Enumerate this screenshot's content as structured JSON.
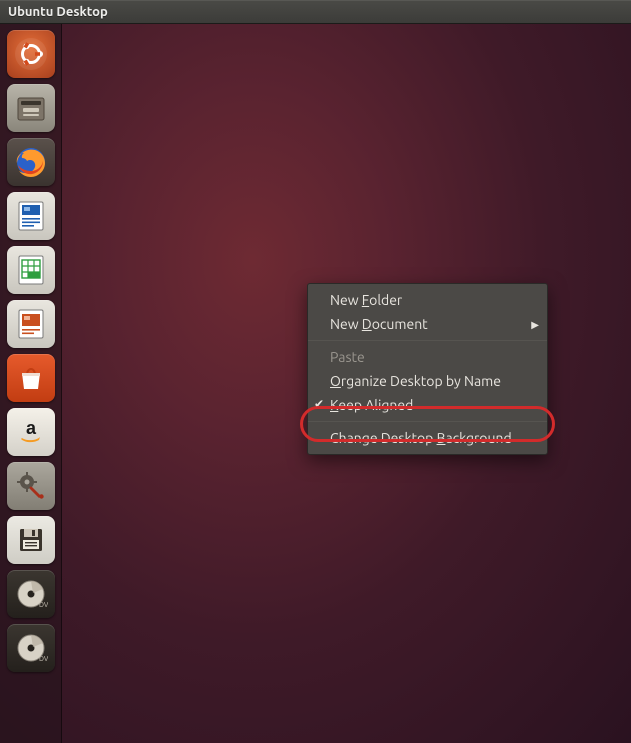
{
  "top_panel": {
    "title": "Ubuntu Desktop"
  },
  "launcher": {
    "items": [
      {
        "name": "dash-home",
        "tooltip": "Dash Home"
      },
      {
        "name": "files",
        "tooltip": "Files"
      },
      {
        "name": "firefox",
        "tooltip": "Firefox Web Browser"
      },
      {
        "name": "libreoffice-writer",
        "tooltip": "LibreOffice Writer"
      },
      {
        "name": "libreoffice-calc",
        "tooltip": "LibreOffice Calc"
      },
      {
        "name": "libreoffice-impress",
        "tooltip": "LibreOffice Impress"
      },
      {
        "name": "ubuntu-software-center",
        "tooltip": "Ubuntu Software Center"
      },
      {
        "name": "amazon",
        "tooltip": "Amazon"
      },
      {
        "name": "system-settings",
        "tooltip": "System Settings"
      },
      {
        "name": "save-device",
        "tooltip": "Floppy Disk"
      },
      {
        "name": "disc-1",
        "tooltip": "Disc"
      },
      {
        "name": "disc-2",
        "tooltip": "Disc"
      }
    ]
  },
  "context_menu": {
    "items": [
      {
        "kind": "item",
        "label": "New Folder",
        "mnemonic_index": 4,
        "enabled": true,
        "submenu": false
      },
      {
        "kind": "item",
        "label": "New Document",
        "mnemonic_index": 4,
        "enabled": true,
        "submenu": true
      },
      {
        "kind": "separator"
      },
      {
        "kind": "item",
        "label": "Paste",
        "mnemonic_index": -1,
        "enabled": false,
        "submenu": false
      },
      {
        "kind": "item",
        "label": "Organize Desktop by Name",
        "mnemonic_index": 0,
        "enabled": true,
        "submenu": false
      },
      {
        "kind": "check",
        "label": "Keep Aligned",
        "mnemonic_index": 0,
        "checked": true,
        "enabled": true
      },
      {
        "kind": "separator"
      },
      {
        "kind": "item",
        "label": "Change Desktop Background",
        "mnemonic_index": 15,
        "enabled": true,
        "submenu": false
      }
    ]
  },
  "annotation": {
    "highlighted_item_label": "Change Desktop Background"
  }
}
